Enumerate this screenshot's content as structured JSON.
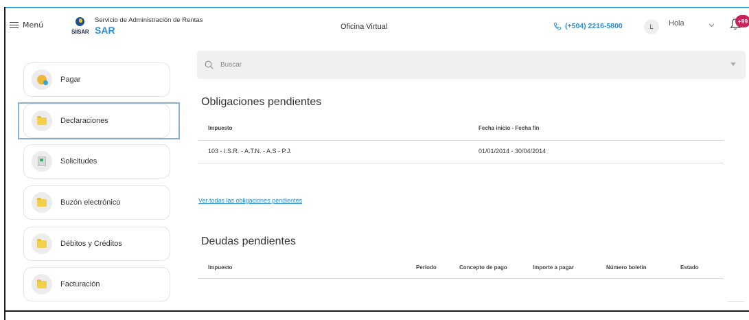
{
  "header": {
    "menu_label": "Menú",
    "brand_title": "Servicio de Administración de Rentas",
    "brand_short": "SAR",
    "brand_logo_text": "SIISAR",
    "center_title": "Oficina Virtual",
    "phone": "(+504) 2216-5800",
    "avatar_initial": "L",
    "greeting": "Hola",
    "notifications_badge": "+99"
  },
  "sidebar": {
    "items": [
      {
        "label": "Pagar",
        "icon": "coin-icon"
      },
      {
        "label": "Declaraciones",
        "icon": "folder-icon"
      },
      {
        "label": "Solicitudes",
        "icon": "documents-icon"
      },
      {
        "label": "Buzón electrónico",
        "icon": "folder-icon"
      },
      {
        "label": "Débitos y Créditos",
        "icon": "folder-icon"
      },
      {
        "label": "Facturación",
        "icon": "folder-icon"
      }
    ],
    "selected": "Declaraciones"
  },
  "search": {
    "placeholder": "Buscar"
  },
  "obligaciones": {
    "title": "Obligaciones pendientes",
    "columns": [
      "Impuesto",
      "Fecha inicio - Fecha fin"
    ],
    "rows": [
      {
        "impuesto": "103 - I.S.R. - A.T.N. - A.S - P.J.",
        "fechas": "01/01/2014 - 30/04/2014"
      }
    ],
    "link": "Ver todas las obligaciones pendientes"
  },
  "deudas": {
    "title": "Deudas pendientes",
    "columns": [
      "Impuesto",
      "Período",
      "Concepto de pago",
      "Importe a pagar",
      "Número boletín",
      "Estado"
    ]
  },
  "colors": {
    "accent": "#2b8fd6",
    "badge": "#c8225a",
    "folder": "#f2d04e"
  }
}
